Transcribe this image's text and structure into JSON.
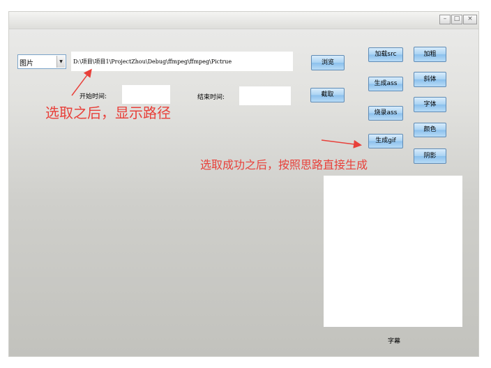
{
  "window": {
    "controls": {
      "minimize": "–",
      "maximize": "□",
      "close": "×"
    }
  },
  "source": {
    "type_value": "图片",
    "type_arrow": "▼",
    "path_value": "D:\\项目\\项目1\\ProjectZhou\\Debug\\ffmpeg\\ffmpeg\\Pictrue",
    "browse_label": "浏览"
  },
  "time": {
    "start_label": "开始时间:",
    "end_label": "结束时间:",
    "start_value": "",
    "end_value": ""
  },
  "actions": {
    "cut_label": "截取",
    "load_src_label": "加载src",
    "gen_ass_label": "生成ass",
    "burn_ass_label": "烧录ass",
    "gen_gif_label": "生成gif"
  },
  "style": {
    "bold_label": "加粗",
    "italic_label": "斜体",
    "font_label": "字体",
    "color_label": "颜色",
    "shadow_label": "阴影"
  },
  "preview": {
    "caption": "字幕"
  },
  "annotations": {
    "path_note": "选取之后，显示路径",
    "gif_note": "选取成功之后，按照思路直接生成",
    "color": "#e8403a"
  }
}
